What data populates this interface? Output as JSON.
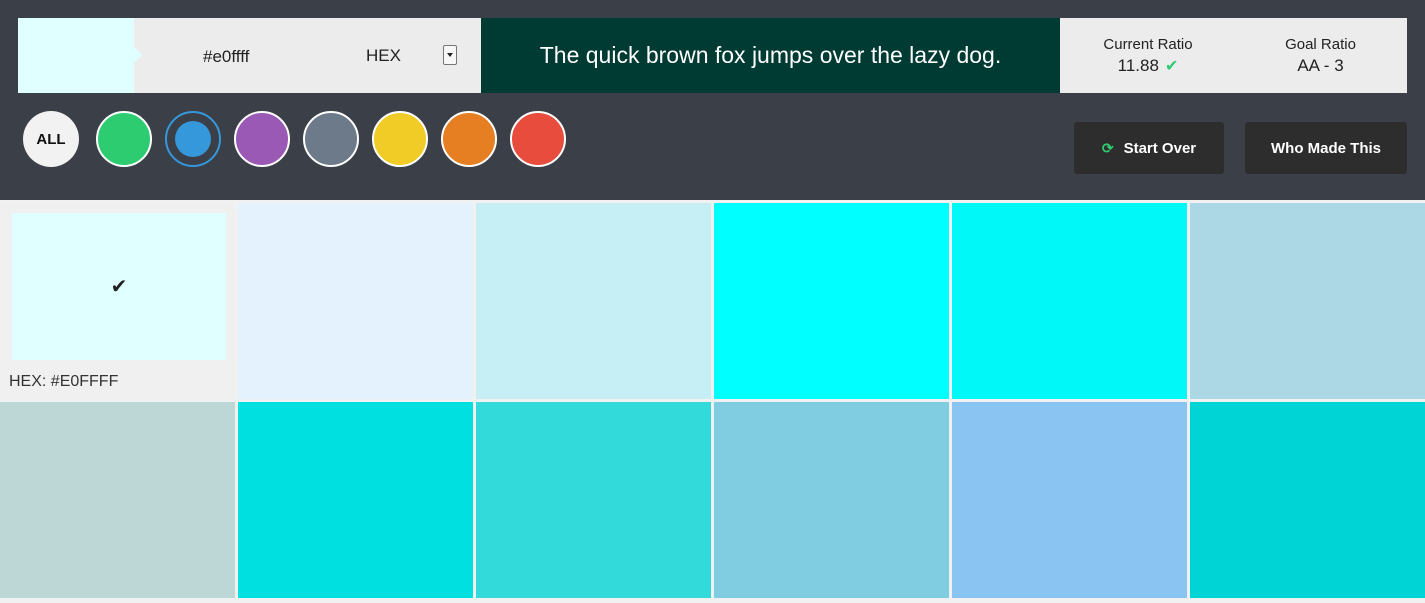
{
  "picker": {
    "color": "#e0ffff",
    "value": "#e0ffff",
    "format": "HEX"
  },
  "sample": {
    "text": "The quick brown fox jumps over the lazy dog.",
    "background": "#003b33",
    "foreground": "#ffffff"
  },
  "ratio": {
    "current_label": "Current Ratio",
    "current_value": "11.88",
    "check_icon": "✔",
    "goal_label": "Goal Ratio",
    "goal_value": "AA - 3"
  },
  "filters": [
    {
      "name": "all",
      "label": "ALL",
      "color": "#f2f2f2"
    },
    {
      "name": "green",
      "color": "#2ecc71"
    },
    {
      "name": "blue",
      "color": "#3498db",
      "selected": true
    },
    {
      "name": "purple",
      "color": "#9b59b6"
    },
    {
      "name": "gray",
      "color": "#6c7a89"
    },
    {
      "name": "yellow",
      "color": "#f1cb26"
    },
    {
      "name": "orange",
      "color": "#e67e22"
    },
    {
      "name": "red",
      "color": "#e74c3c"
    }
  ],
  "buttons": {
    "start_over": "Start Over",
    "refresh_icon": "⟳",
    "who_made_this": "Who Made This"
  },
  "swatches": [
    {
      "color": "#e0ffff",
      "selected": true,
      "caption": "HEX: #E0FFFF",
      "check": "✔"
    },
    {
      "color": "#e3f2fd"
    },
    {
      "color": "#c5eef5"
    },
    {
      "color": "#00ffff"
    },
    {
      "color": "#00f8f8"
    },
    {
      "color": "#acd8e5"
    },
    {
      "color": "#bdd6d6"
    },
    {
      "color": "#00e0e0"
    },
    {
      "color": "#33dada"
    },
    {
      "color": "#80cce0"
    },
    {
      "color": "#8ac4f2"
    },
    {
      "color": "#00d4d4"
    }
  ]
}
